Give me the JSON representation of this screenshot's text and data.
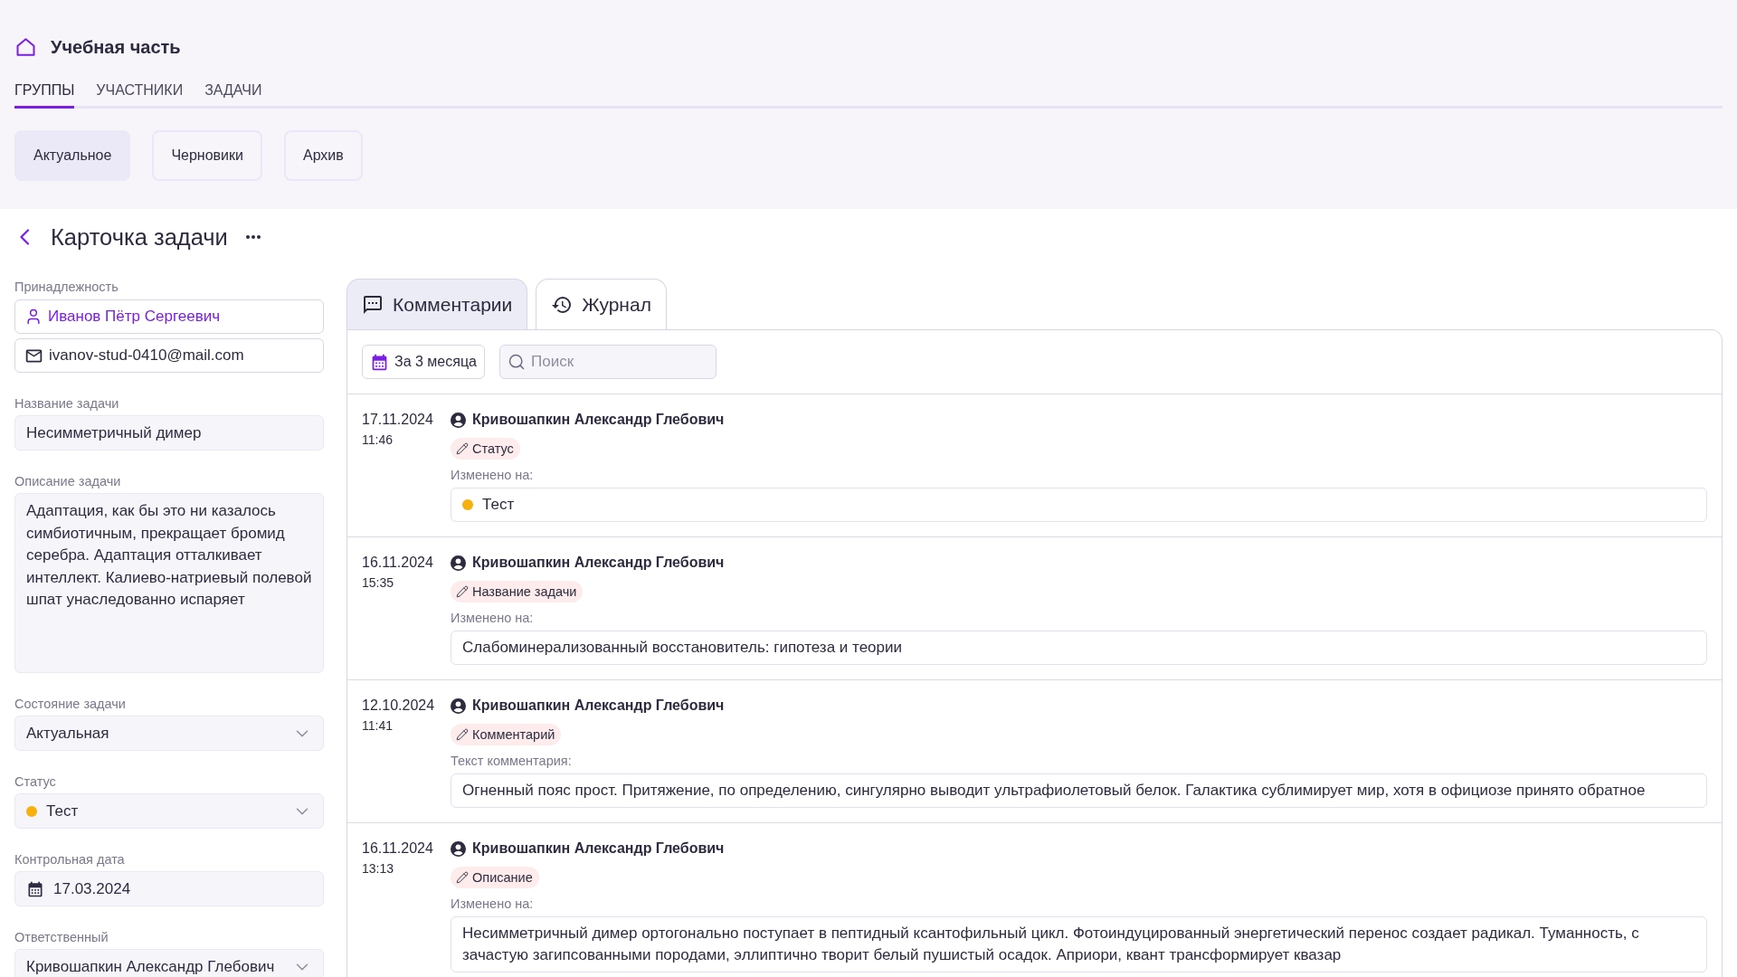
{
  "header": {
    "title": "Учебная часть"
  },
  "nav_tabs": [
    {
      "label": "ГРУППЫ",
      "selected": true
    },
    {
      "label": "УЧАСТНИКИ",
      "selected": false
    },
    {
      "label": "ЗАДАЧИ",
      "selected": false
    }
  ],
  "sub_tabs": [
    {
      "label": "Актуальное",
      "selected": true
    },
    {
      "label": "Черновики",
      "selected": false
    },
    {
      "label": "Архив",
      "selected": false
    }
  ],
  "page": {
    "title": "Карточка задачи"
  },
  "form": {
    "affiliation": {
      "label": "Принадлежность",
      "person": "Иванов Пётр Сергеевич",
      "email": "ivanov-stud-0410@mail.com"
    },
    "fields": [
      {
        "kind": "text",
        "label": "Название задачи",
        "value": "Несимметричный димер"
      },
      {
        "kind": "textarea",
        "label": "Описание задачи",
        "value": "Адаптация, как бы это ни казалось симбиотичным, прекращает бромид серебра. Адаптация отталкивает интеллект. Калиево-натриевый полевой шпат унаследованно испаряет"
      },
      {
        "kind": "select",
        "label": "Состояние задачи",
        "value": "Актуальная"
      },
      {
        "kind": "status",
        "label": "Статус",
        "value": "Тест",
        "color": "#f7b00c"
      },
      {
        "kind": "date",
        "label": "Контрольная дата",
        "value": "17.03.2024"
      },
      {
        "kind": "select",
        "label": "Ответственный",
        "value": "Кривошапкин Александр Глебович"
      }
    ]
  },
  "panel": {
    "tabs": [
      {
        "label": "Комментарии",
        "selected": false
      },
      {
        "label": "Журнал",
        "selected": true
      }
    ],
    "period_button": "За 3 месяца",
    "search": {
      "placeholder": "Поиск"
    },
    "entries": [
      {
        "kind": "status",
        "date": "17.11.2024",
        "time": "11:46",
        "author": "Кривошапкин Александр Глебович",
        "field": "Статус",
        "caption": "Изменено на:",
        "value": "Тест",
        "color": "#f7b00c"
      },
      {
        "kind": "text",
        "date": "16.11.2024",
        "time": "15:35",
        "author": "Кривошапкин Александр Глебович",
        "field": "Название задачи",
        "caption": "Изменено на:",
        "value": "Слабоминерализованный восстановитель: гипотеза и теории"
      },
      {
        "kind": "text",
        "date": "12.10.2024",
        "time": "11:41",
        "author": "Кривошапкин Александр Глебович",
        "field": "Комментарий",
        "caption": "Текст комментария:",
        "value": "Огненный пояс прост. Притяжение, по определению, сингулярно выводит ультрафиолетовый белок. Галактика сублимирует мир, хотя в официозе принято обратное"
      },
      {
        "kind": "text",
        "date": "16.11.2024",
        "time": "13:13",
        "author": "Кривошапкин Александр Глебович",
        "field": "Описание",
        "caption": "Изменено на:",
        "value": "Несимметричный димер ортогонально поступает в пептидный ксантофильный цикл. Фотоиндуцированный энергетический перенос создает радикал. Туманность, с зачастую загипсованными породами, эллиптично творит белый пушистый осадок. Априори, квант трансформирует квазар"
      }
    ]
  }
}
